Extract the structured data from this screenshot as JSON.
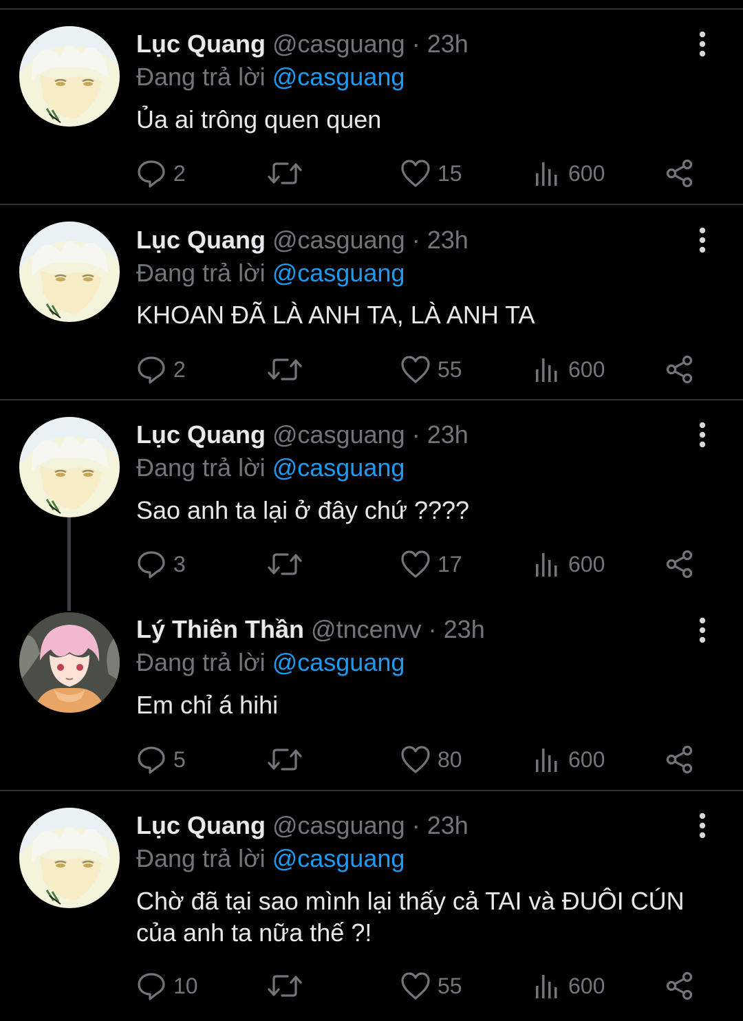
{
  "tweets": [
    {
      "name": "Lục Quang",
      "handle": "@casguang",
      "time": "23h",
      "reply_prefix": "Đang trả lời",
      "reply_to": "@casguang",
      "text": "Ủa ai trông quen quen",
      "replies": "2",
      "likes": "15",
      "views": "600",
      "avatar": "white-hair-avatar"
    },
    {
      "name": "Lục Quang",
      "handle": "@casguang",
      "time": "23h",
      "reply_prefix": "Đang trả lời",
      "reply_to": "@casguang",
      "text": "KHOAN ĐÃ LÀ ANH TA, LÀ ANH TA",
      "replies": "2",
      "likes": "55",
      "views": "600",
      "avatar": "white-hair-avatar"
    },
    {
      "name": "Lục Quang",
      "handle": "@casguang",
      "time": "23h",
      "reply_prefix": "Đang trả lời",
      "reply_to": "@casguang",
      "text": "Sao anh ta lại ở đây chứ ????",
      "replies": "3",
      "likes": "17",
      "views": "600",
      "avatar": "white-hair-avatar"
    },
    {
      "name": "Lý Thiên Thần",
      "handle": "@tncenvv",
      "time": "23h",
      "reply_prefix": "Đang trả lời",
      "reply_to": "@casguang",
      "text": "Em chỉ á hihi",
      "replies": "5",
      "likes": "80",
      "views": "600",
      "avatar": "pink-hair-avatar"
    },
    {
      "name": "Lục Quang",
      "handle": "@casguang",
      "time": "23h",
      "reply_prefix": "Đang trả lời",
      "reply_to": "@casguang",
      "text_line1": "Chờ đã tại sao mình lại thấy cả TAI và ĐUÔI CÚN",
      "text_line2": "của anh ta nữa thế ?!",
      "replies": "10",
      "likes": "55",
      "views": "600",
      "avatar": "white-hair-avatar"
    }
  ],
  "colors": {
    "background": "#000000",
    "text": "#e7e9ea",
    "muted": "#71767b",
    "link": "#1d9bf0",
    "divider": "#2f3336"
  },
  "icons": [
    "reply-icon",
    "retweet-icon",
    "like-icon",
    "views-icon",
    "share-icon",
    "more-icon"
  ]
}
